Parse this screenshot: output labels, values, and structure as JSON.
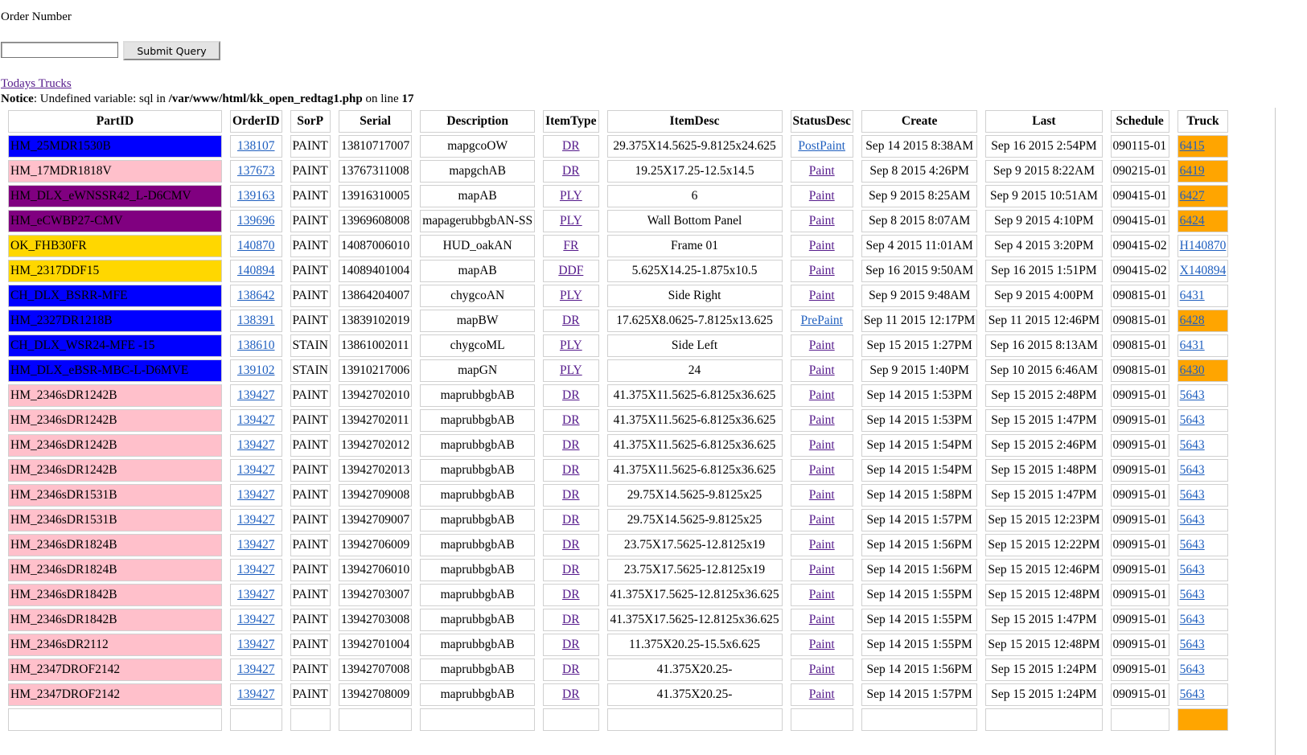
{
  "form": {
    "label": "Order Number",
    "input_value": "",
    "submit_label": "Submit Query"
  },
  "links": {
    "todays_trucks": "Todays Trucks"
  },
  "notice": {
    "prefix": "Notice",
    "text1": ": Undefined variable: sql in ",
    "path": "/var/www/html/kk_open_redtag1.php",
    "text2": " on line ",
    "line": "17"
  },
  "colors": {
    "blue": "#0000ff",
    "pink": "#ffc0cb",
    "purple": "#800080",
    "gold": "#ffd700",
    "orange": "#ffa500"
  },
  "table": {
    "headers": [
      "PartID",
      "OrderID",
      "SorP",
      "Serial",
      "Description",
      "ItemType",
      "ItemDesc",
      "StatusDesc",
      "Create",
      "Last",
      "Schedule",
      "Truck"
    ],
    "rows": [
      {
        "part": "HM_25MDR1530B",
        "color": "blue",
        "order": "138107",
        "sorp": "PAINT",
        "serial": "13810717007",
        "desc": "mapgcoOW",
        "itemtype": "DR",
        "itemdesc": "29.375X14.5625-9.8125x24.625",
        "status": "PostPaint",
        "create": "Sep 14 2015 8:38AM",
        "last": "Sep 16 2015 2:54PM",
        "schedule": "090115-01",
        "truck": "6415",
        "truck_color": "orange"
      },
      {
        "part": "HM_17MDR1818V",
        "color": "pink",
        "order": "137673",
        "sorp": "PAINT",
        "serial": "13767311008",
        "desc": "mapgchAB",
        "itemtype": "DR",
        "itemdesc": "19.25X17.25-12.5x14.5",
        "status": "Paint",
        "create": "Sep 8 2015 4:26PM",
        "last": "Sep 9 2015 8:22AM",
        "schedule": "090215-01",
        "truck": "6419",
        "truck_color": "orange"
      },
      {
        "part": "HM_DLX_eWNSSR42_L-D6CMV",
        "color": "purple",
        "order": "139163",
        "sorp": "PAINT",
        "serial": "13916310005",
        "desc": "mapAB",
        "itemtype": "PLY",
        "itemdesc": "6",
        "status": "Paint",
        "create": "Sep 9 2015 8:25AM",
        "last": "Sep 9 2015 10:51AM",
        "schedule": "090415-01",
        "truck": "6427",
        "truck_color": "orange"
      },
      {
        "part": "HM_eCWBP27-CMV",
        "color": "purple",
        "order": "139696",
        "sorp": "PAINT",
        "serial": "13969608008",
        "desc": "mapagerubbgbAN-SS",
        "itemtype": "PLY",
        "itemdesc": "Wall Bottom Panel",
        "status": "Paint",
        "create": "Sep 8 2015 8:07AM",
        "last": "Sep 9 2015 4:10PM",
        "schedule": "090415-01",
        "truck": "6424",
        "truck_color": "orange"
      },
      {
        "part": "OK_FHB30FR",
        "color": "gold",
        "order": "140870",
        "sorp": "PAINT",
        "serial": "14087006010",
        "desc": "HUD_oakAN",
        "itemtype": "FR",
        "itemdesc": "Frame 01",
        "status": "Paint",
        "create": "Sep 4 2015 11:01AM",
        "last": "Sep 4 2015 3:20PM",
        "schedule": "090415-02",
        "truck": "H140870",
        "truck_color": ""
      },
      {
        "part": "HM_2317DDF15",
        "color": "gold",
        "order": "140894",
        "sorp": "PAINT",
        "serial": "14089401004",
        "desc": "mapAB",
        "itemtype": "DDF",
        "itemdesc": "5.625X14.25-1.875x10.5",
        "status": "Paint",
        "create": "Sep 16 2015 9:50AM",
        "last": "Sep 16 2015 1:51PM",
        "schedule": "090415-02",
        "truck": "X140894",
        "truck_color": ""
      },
      {
        "part": "CH_DLX_BSRR-MFE",
        "color": "blue",
        "order": "138642",
        "sorp": "PAINT",
        "serial": "13864204007",
        "desc": "chygcoAN",
        "itemtype": "PLY",
        "itemdesc": "Side Right",
        "status": "Paint",
        "create": "Sep 9 2015 9:48AM",
        "last": "Sep 9 2015 4:00PM",
        "schedule": "090815-01",
        "truck": "6431",
        "truck_color": ""
      },
      {
        "part": "HM_2327DR1218B",
        "color": "blue",
        "order": "138391",
        "sorp": "PAINT",
        "serial": "13839102019",
        "desc": "mapBW",
        "itemtype": "DR",
        "itemdesc": "17.625X8.0625-7.8125x13.625",
        "status": "PrePaint",
        "create": "Sep 11 2015 12:17PM",
        "last": "Sep 11 2015 12:46PM",
        "schedule": "090815-01",
        "truck": "6428",
        "truck_color": "orange"
      },
      {
        "part": "CH_DLX_WSR24-MFE -15",
        "color": "blue",
        "order": "138610",
        "sorp": "STAIN",
        "serial": "13861002011",
        "desc": "chygcoML",
        "itemtype": "PLY",
        "itemdesc": "Side Left",
        "status": "Paint",
        "create": "Sep 15 2015 1:27PM",
        "last": "Sep 16 2015 8:13AM",
        "schedule": "090815-01",
        "truck": "6431",
        "truck_color": ""
      },
      {
        "part": "HM_DLX_eBSR-MBC-L-D6MVE",
        "color": "blue",
        "order": "139102",
        "sorp": "STAIN",
        "serial": "13910217006",
        "desc": "mapGN",
        "itemtype": "PLY",
        "itemdesc": "24",
        "status": "Paint",
        "create": "Sep 9 2015 1:40PM",
        "last": "Sep 10 2015 6:46AM",
        "schedule": "090815-01",
        "truck": "6430",
        "truck_color": "orange"
      },
      {
        "part": "HM_2346sDR1242B",
        "color": "pink",
        "order": "139427",
        "sorp": "PAINT",
        "serial": "13942702010",
        "desc": "maprubbgbAB",
        "itemtype": "DR",
        "itemdesc": "41.375X11.5625-6.8125x36.625",
        "status": "Paint",
        "create": "Sep 14 2015 1:53PM",
        "last": "Sep 15 2015 2:48PM",
        "schedule": "090915-01",
        "truck": "5643",
        "truck_color": ""
      },
      {
        "part": "HM_2346sDR1242B",
        "color": "pink",
        "order": "139427",
        "sorp": "PAINT",
        "serial": "13942702011",
        "desc": "maprubbgbAB",
        "itemtype": "DR",
        "itemdesc": "41.375X11.5625-6.8125x36.625",
        "status": "Paint",
        "create": "Sep 14 2015 1:53PM",
        "last": "Sep 15 2015 1:47PM",
        "schedule": "090915-01",
        "truck": "5643",
        "truck_color": ""
      },
      {
        "part": "HM_2346sDR1242B",
        "color": "pink",
        "order": "139427",
        "sorp": "PAINT",
        "serial": "13942702012",
        "desc": "maprubbgbAB",
        "itemtype": "DR",
        "itemdesc": "41.375X11.5625-6.8125x36.625",
        "status": "Paint",
        "create": "Sep 14 2015 1:54PM",
        "last": "Sep 15 2015 2:46PM",
        "schedule": "090915-01",
        "truck": "5643",
        "truck_color": ""
      },
      {
        "part": "HM_2346sDR1242B",
        "color": "pink",
        "order": "139427",
        "sorp": "PAINT",
        "serial": "13942702013",
        "desc": "maprubbgbAB",
        "itemtype": "DR",
        "itemdesc": "41.375X11.5625-6.8125x36.625",
        "status": "Paint",
        "create": "Sep 14 2015 1:54PM",
        "last": "Sep 15 2015 1:48PM",
        "schedule": "090915-01",
        "truck": "5643",
        "truck_color": ""
      },
      {
        "part": "HM_2346sDR1531B",
        "color": "pink",
        "order": "139427",
        "sorp": "PAINT",
        "serial": "13942709008",
        "desc": "maprubbgbAB",
        "itemtype": "DR",
        "itemdesc": "29.75X14.5625-9.8125x25",
        "status": "Paint",
        "create": "Sep 14 2015 1:58PM",
        "last": "Sep 15 2015 1:47PM",
        "schedule": "090915-01",
        "truck": "5643",
        "truck_color": ""
      },
      {
        "part": "HM_2346sDR1531B",
        "color": "pink",
        "order": "139427",
        "sorp": "PAINT",
        "serial": "13942709007",
        "desc": "maprubbgbAB",
        "itemtype": "DR",
        "itemdesc": "29.75X14.5625-9.8125x25",
        "status": "Paint",
        "create": "Sep 14 2015 1:57PM",
        "last": "Sep 15 2015 12:23PM",
        "schedule": "090915-01",
        "truck": "5643",
        "truck_color": ""
      },
      {
        "part": "HM_2346sDR1824B",
        "color": "pink",
        "order": "139427",
        "sorp": "PAINT",
        "serial": "13942706009",
        "desc": "maprubbgbAB",
        "itemtype": "DR",
        "itemdesc": "23.75X17.5625-12.8125x19",
        "status": "Paint",
        "create": "Sep 14 2015 1:56PM",
        "last": "Sep 15 2015 12:22PM",
        "schedule": "090915-01",
        "truck": "5643",
        "truck_color": ""
      },
      {
        "part": "HM_2346sDR1824B",
        "color": "pink",
        "order": "139427",
        "sorp": "PAINT",
        "serial": "13942706010",
        "desc": "maprubbgbAB",
        "itemtype": "DR",
        "itemdesc": "23.75X17.5625-12.8125x19",
        "status": "Paint",
        "create": "Sep 14 2015 1:56PM",
        "last": "Sep 15 2015 12:46PM",
        "schedule": "090915-01",
        "truck": "5643",
        "truck_color": ""
      },
      {
        "part": "HM_2346sDR1842B",
        "color": "pink",
        "order": "139427",
        "sorp": "PAINT",
        "serial": "13942703007",
        "desc": "maprubbgbAB",
        "itemtype": "DR",
        "itemdesc": "41.375X17.5625-12.8125x36.625",
        "status": "Paint",
        "create": "Sep 14 2015 1:55PM",
        "last": "Sep 15 2015 12:48PM",
        "schedule": "090915-01",
        "truck": "5643",
        "truck_color": ""
      },
      {
        "part": "HM_2346sDR1842B",
        "color": "pink",
        "order": "139427",
        "sorp": "PAINT",
        "serial": "13942703008",
        "desc": "maprubbgbAB",
        "itemtype": "DR",
        "itemdesc": "41.375X17.5625-12.8125x36.625",
        "status": "Paint",
        "create": "Sep 14 2015 1:55PM",
        "last": "Sep 15 2015 1:47PM",
        "schedule": "090915-01",
        "truck": "5643",
        "truck_color": ""
      },
      {
        "part": "HM_2346sDR2112",
        "color": "pink",
        "order": "139427",
        "sorp": "PAINT",
        "serial": "13942701004",
        "desc": "maprubbgbAB",
        "itemtype": "DR",
        "itemdesc": "11.375X20.25-15.5x6.625",
        "status": "Paint",
        "create": "Sep 14 2015 1:55PM",
        "last": "Sep 15 2015 12:48PM",
        "schedule": "090915-01",
        "truck": "5643",
        "truck_color": ""
      },
      {
        "part": "HM_2347DROF2142",
        "color": "pink",
        "order": "139427",
        "sorp": "PAINT",
        "serial": "13942707008",
        "desc": "maprubbgbAB",
        "itemtype": "DR",
        "itemdesc": "41.375X20.25-",
        "status": "Paint",
        "create": "Sep 14 2015 1:56PM",
        "last": "Sep 15 2015 1:24PM",
        "schedule": "090915-01",
        "truck": "5643",
        "truck_color": ""
      },
      {
        "part": "HM_2347DROF2142",
        "color": "pink",
        "order": "139427",
        "sorp": "PAINT",
        "serial": "13942708009",
        "desc": "maprubbgbAB",
        "itemtype": "DR",
        "itemdesc": "41.375X20.25-",
        "status": "Paint",
        "create": "Sep 14 2015 1:57PM",
        "last": "Sep 15 2015 1:24PM",
        "schedule": "090915-01",
        "truck": "5643",
        "truck_color": ""
      },
      {
        "part": "",
        "color": "",
        "order": "",
        "sorp": "",
        "serial": "",
        "desc": "",
        "itemtype": "",
        "itemdesc": "",
        "status": "",
        "create": "",
        "last": "",
        "schedule": "",
        "truck": "",
        "truck_color": "orange"
      }
    ]
  }
}
